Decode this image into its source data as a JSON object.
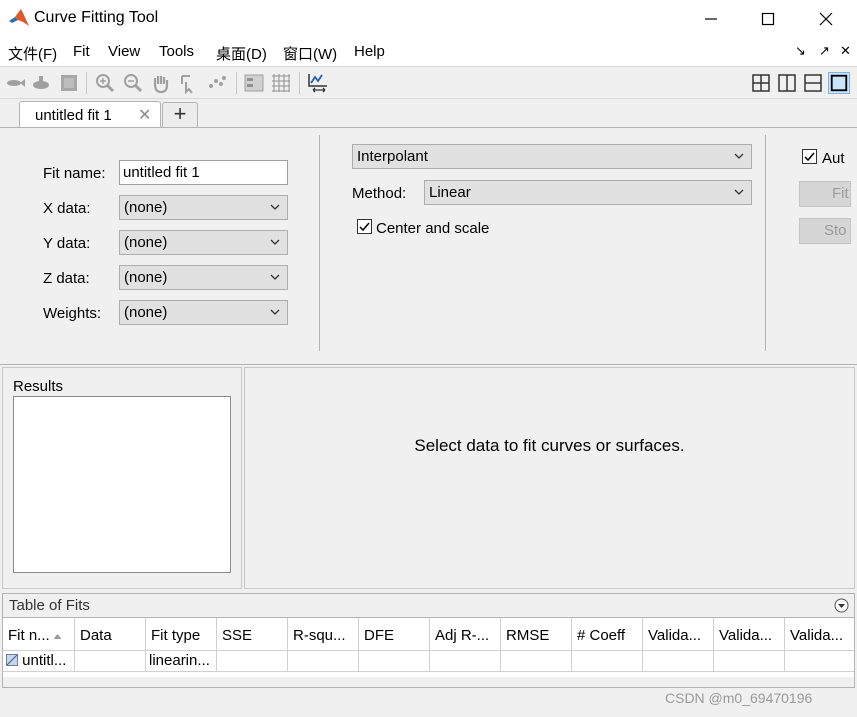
{
  "window": {
    "title": "Curve Fitting Tool"
  },
  "menu": {
    "items": [
      "文件(F)",
      "Fit",
      "View",
      "Tools",
      "桌面(D)",
      "窗口(W)",
      "Help"
    ],
    "right_arrows": [
      "↘",
      "↗",
      "✕"
    ]
  },
  "tabs": {
    "active_label": "untitled fit 1",
    "close_glyph": "✕",
    "add_glyph": "+"
  },
  "fit_panel": {
    "fit_name_label": "Fit name:",
    "fit_name_value": "untitled fit 1",
    "x_data_label": "X data:",
    "x_data_value": "(none)",
    "y_data_label": "Y data:",
    "y_data_value": "(none)",
    "z_data_label": "Z data:",
    "z_data_value": "(none)",
    "weights_label": "Weights:",
    "weights_value": "(none)",
    "fit_type_value": "Interpolant",
    "method_label": "Method:",
    "method_value": "Linear",
    "center_scale_label": "Center and scale",
    "center_scale_checked": true,
    "auto_label": "Aut",
    "auto_checked": true,
    "fit_button_label": "Fit",
    "stop_button_label": "Sto"
  },
  "results": {
    "title": "Results"
  },
  "plot": {
    "message": "Select data to fit curves or surfaces."
  },
  "table_of_fits": {
    "title": "Table of Fits",
    "columns": [
      "Fit n...",
      "Data",
      "Fit type",
      "SSE",
      "R-squ...",
      "DFE",
      "Adj R-...",
      "RMSE",
      "# Coeff",
      "Valida...",
      "Valida...",
      "Valida..."
    ],
    "rows": [
      [
        "untitl...",
        "",
        "linearin...",
        "",
        "",
        "",
        "",
        "",
        "",
        "",
        "",
        ""
      ]
    ]
  },
  "watermark": "CSDN @m0_69470196",
  "colors": {
    "accent": "#0072bd",
    "window_bg": "#f0f0f0"
  }
}
